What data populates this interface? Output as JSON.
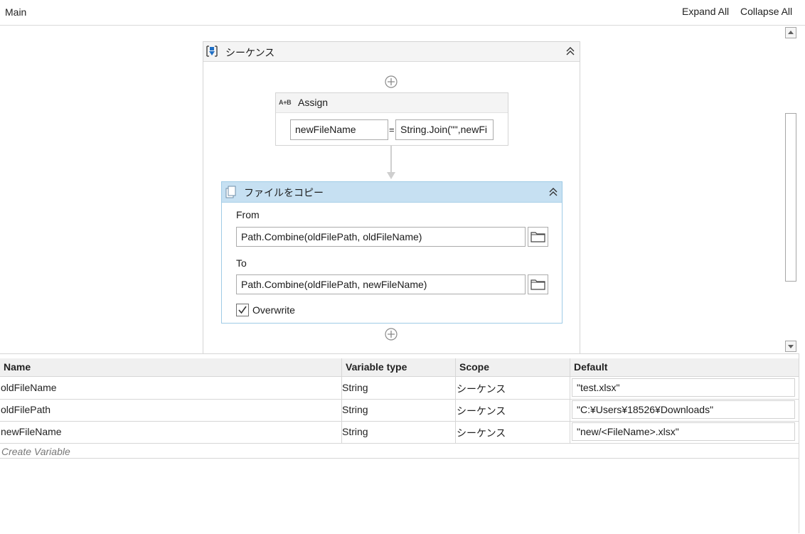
{
  "header": {
    "breadcrumb": "Main",
    "expand_all": "Expand All",
    "collapse_all": "Collapse All"
  },
  "sequence": {
    "title": "シーケンス",
    "icon": "sequence-icon"
  },
  "assign": {
    "title": "Assign",
    "icon_text": "A+B",
    "to_value": "newFileName",
    "equals": "=",
    "value_expr": "String.Join(\"\",newFi"
  },
  "copy_file": {
    "title": "ファイルをコピー",
    "from_label": "From",
    "from_value": "Path.Combine(oldFilePath, oldFileName)",
    "to_label": "To",
    "to_value": "Path.Combine(oldFilePath, newFileName)",
    "overwrite_label": "Overwrite",
    "overwrite_checked": true
  },
  "variables": {
    "columns": [
      "Name",
      "Variable type",
      "Scope",
      "Default"
    ],
    "rows": [
      {
        "name": "oldFileName",
        "type": "String",
        "scope": "シーケンス",
        "default": "\"test.xlsx\""
      },
      {
        "name": "oldFilePath",
        "type": "String",
        "scope": "シーケンス",
        "default": "\"C:¥Users¥18526¥Downloads\""
      },
      {
        "name": "newFileName",
        "type": "String",
        "scope": "シーケンス",
        "default": "\"new/<FileName>.xlsx\""
      }
    ],
    "create_label": "Create Variable"
  },
  "colors": {
    "copy_header": "#c6e0f2",
    "copy_border": "#9fcbe6",
    "sequence_icon": "#1f6fc5"
  }
}
